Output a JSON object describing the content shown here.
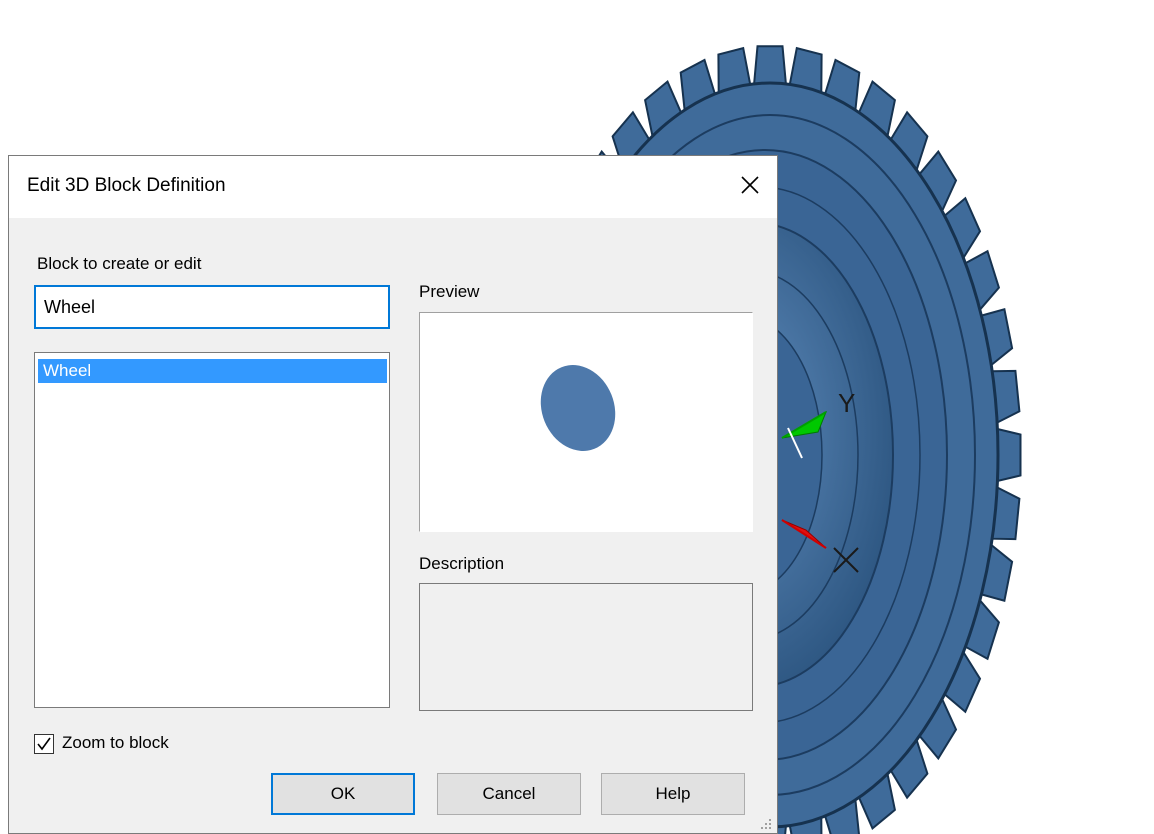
{
  "dialog": {
    "title": "Edit 3D Block Definition",
    "close_icon": "close-icon"
  },
  "block_section": {
    "label": "Block to create or edit",
    "input_value": "Wheel",
    "list_items": [
      "Wheel"
    ],
    "selected_index": 0
  },
  "preview": {
    "label": "Preview"
  },
  "description": {
    "label": "Description",
    "value": ""
  },
  "zoom_to_block": {
    "label": "Zoom to block",
    "checked": true
  },
  "buttons": {
    "ok": "OK",
    "cancel": "Cancel",
    "help": "Help"
  },
  "viewport": {
    "model_color": "#3f6b9a",
    "axis_labels": {
      "y": "Y",
      "x": "X"
    },
    "ucs_colors": {
      "y": "#00c800",
      "x": "#e01010"
    }
  },
  "colors": {
    "accent": "#0078d7",
    "selection": "#3399ff",
    "dialog_bg": "#f0f0f0"
  }
}
